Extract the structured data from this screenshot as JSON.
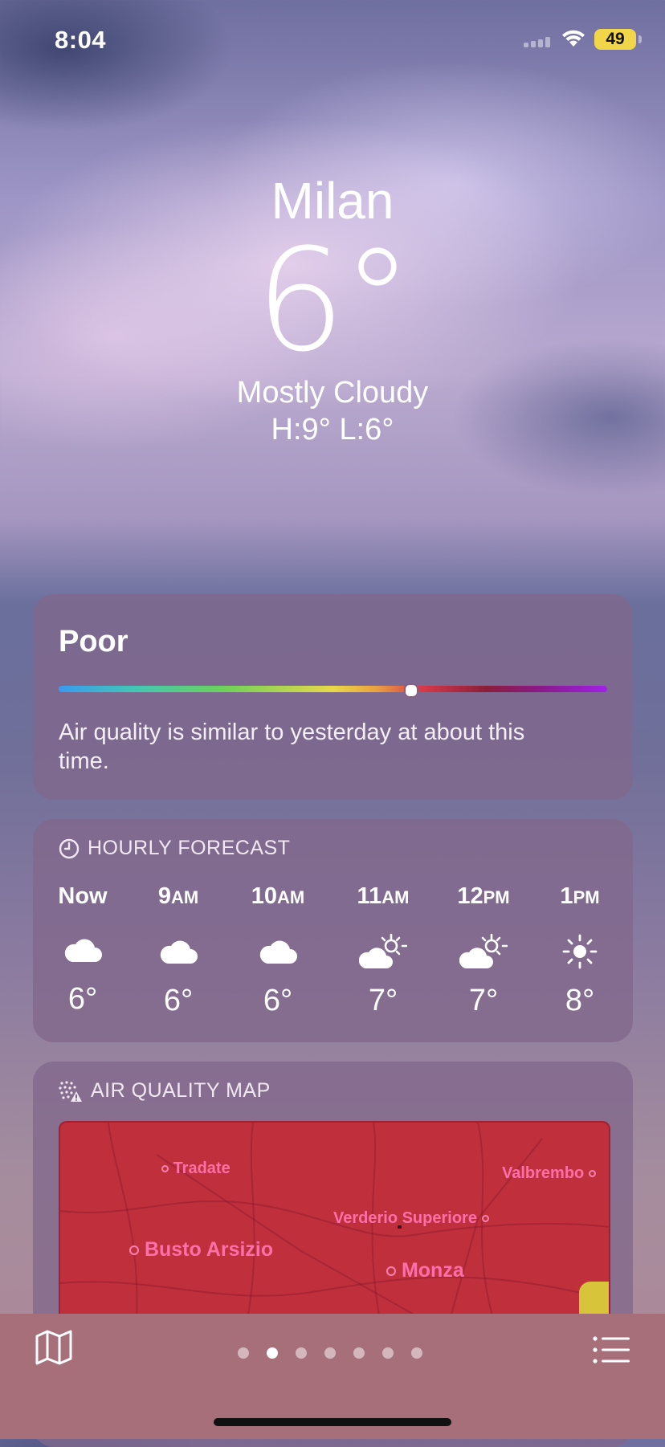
{
  "status_bar": {
    "time": "8:04",
    "battery": "49"
  },
  "location": {
    "city": "Milan",
    "temperature": "6°",
    "condition": "Mostly Cloudy",
    "high_low": "H:9°  L:6°"
  },
  "air_quality": {
    "level": "Poor",
    "scale_position": 0.64,
    "description": "Air quality is similar to yesterday at about this time."
  },
  "hourly": {
    "title": "HOURLY FORECAST",
    "items": [
      {
        "time": "Now",
        "suffix": "",
        "icon": "cloud-icon",
        "temp": "6°"
      },
      {
        "time": "9",
        "suffix": "AM",
        "icon": "cloud-icon",
        "temp": "6°"
      },
      {
        "time": "10",
        "suffix": "AM",
        "icon": "cloud-icon",
        "temp": "6°"
      },
      {
        "time": "11",
        "suffix": "AM",
        "icon": "partly-sunny-icon",
        "temp": "7°"
      },
      {
        "time": "12",
        "suffix": "PM",
        "icon": "partly-sunny-icon",
        "temp": "7°"
      },
      {
        "time": "1",
        "suffix": "PM",
        "icon": "sun-icon",
        "temp": "8°"
      }
    ]
  },
  "air_quality_map": {
    "title": "AIR QUALITY MAP",
    "places": [
      "Tradate",
      "Valbrembo",
      "Verderio Superiore",
      "Busto Arsizio",
      "Monza"
    ]
  },
  "pagination": {
    "count": 7,
    "active": 1
  },
  "colors": {
    "map_fill": "#c02f3c",
    "place_label": "#ff6fa8",
    "toolbar": "#a76f7a"
  }
}
